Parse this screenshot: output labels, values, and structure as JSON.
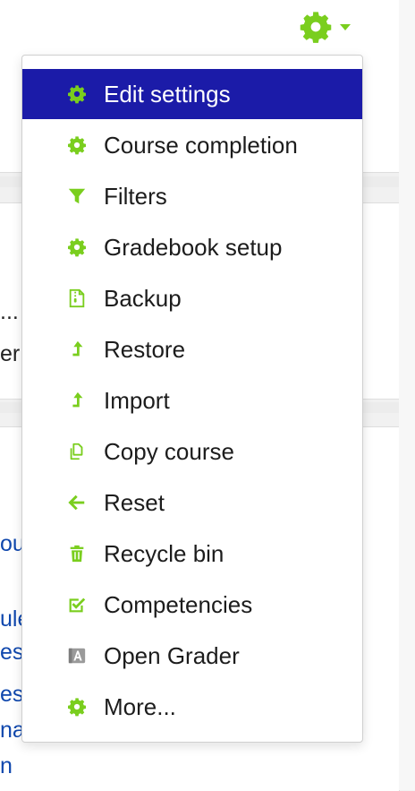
{
  "accent_color": "#7ace1e",
  "active_color": "#1b1ba8",
  "gear_toggle": {
    "icon": "gear-icon"
  },
  "menu": {
    "items": [
      {
        "label": "Edit settings",
        "icon": "gear-icon"
      },
      {
        "label": "Course completion",
        "icon": "gear-icon"
      },
      {
        "label": "Filters",
        "icon": "filter-icon"
      },
      {
        "label": "Gradebook setup",
        "icon": "gear-icon"
      },
      {
        "label": "Backup",
        "icon": "file-zip-icon"
      },
      {
        "label": "Restore",
        "icon": "level-up-icon"
      },
      {
        "label": "Import",
        "icon": "level-up-icon"
      },
      {
        "label": "Copy course",
        "icon": "copy-icon"
      },
      {
        "label": "Reset",
        "icon": "arrow-left-icon"
      },
      {
        "label": "Recycle bin",
        "icon": "trash-icon"
      },
      {
        "label": "Competencies",
        "icon": "check-square-icon"
      },
      {
        "label": "Open Grader",
        "icon": "grader-icon"
      },
      {
        "label": "More...",
        "icon": "gear-icon"
      }
    ]
  },
  "background": {
    "fragments": [
      "...",
      "er",
      "ou",
      "ule",
      "es",
      "es",
      "na",
      "n"
    ]
  }
}
